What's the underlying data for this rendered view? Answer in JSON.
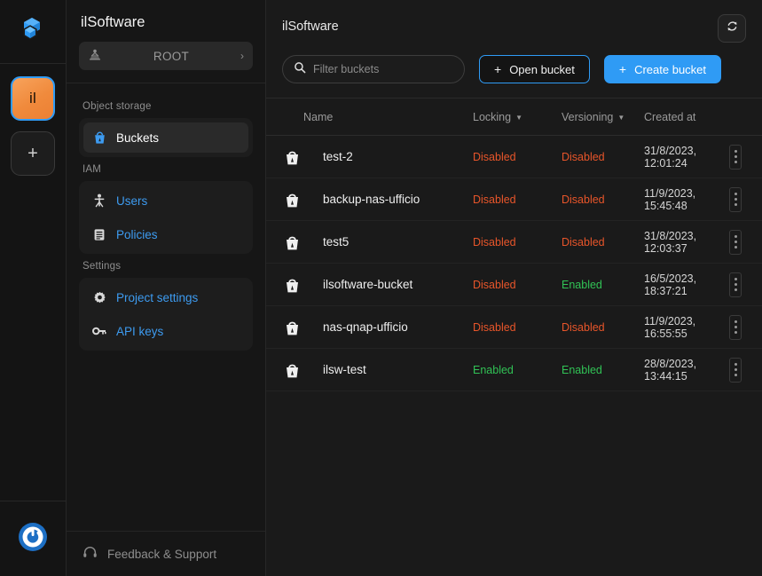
{
  "rail": {
    "logo_icon": "cube-logo-icon",
    "org_tile_label": "il",
    "add_tile_label": "+",
    "bottom_icon": "power-avatar-icon"
  },
  "sidebar": {
    "title": "ilSoftware",
    "org_switcher": {
      "icon": "organization-icon",
      "label": "ROOT",
      "chevron": "›"
    },
    "sections": [
      {
        "label": "Object storage",
        "items": [
          {
            "label": "Buckets",
            "icon": "bucket-icon",
            "active": true
          }
        ]
      },
      {
        "label": "IAM",
        "items": [
          {
            "label": "Users",
            "icon": "user-icon",
            "active": false
          },
          {
            "label": "Policies",
            "icon": "policy-document-icon",
            "active": false
          }
        ]
      },
      {
        "label": "Settings",
        "items": [
          {
            "label": "Project settings",
            "icon": "gear-icon",
            "active": false
          },
          {
            "label": "API keys",
            "icon": "key-icon",
            "active": false
          }
        ]
      }
    ],
    "footer": {
      "label": "Feedback & Support",
      "icon": "headset-icon"
    }
  },
  "main": {
    "title": "ilSoftware",
    "refresh_button": {
      "icon": "refresh-sync-icon",
      "label": ""
    },
    "search": {
      "placeholder": "Filter buckets",
      "value": "",
      "icon": "search-icon"
    },
    "open_bucket_button": {
      "label": "Open bucket",
      "plus": "+"
    },
    "create_bucket_button": {
      "label": "Create bucket",
      "plus": "+"
    },
    "table": {
      "columns": [
        {
          "label": "Name",
          "sortable": false
        },
        {
          "label": "Locking",
          "sortable": true,
          "caret": "▼"
        },
        {
          "label": "Versioning",
          "sortable": true,
          "caret": "▼"
        },
        {
          "label": "Created at",
          "sortable": false
        }
      ],
      "rows": [
        {
          "name": "test-2",
          "locking": "Disabled",
          "locking_state": "off",
          "versioning": "Disabled",
          "versioning_state": "off",
          "created_at": "31/8/2023, 12:01:24"
        },
        {
          "name": "backup-nas-ufficio",
          "locking": "Disabled",
          "locking_state": "off",
          "versioning": "Disabled",
          "versioning_state": "off",
          "created_at": "11/9/2023, 15:45:48"
        },
        {
          "name": "test5",
          "locking": "Disabled",
          "locking_state": "off",
          "versioning": "Disabled",
          "versioning_state": "off",
          "created_at": "31/8/2023, 12:03:37"
        },
        {
          "name": "ilsoftware-bucket",
          "locking": "Disabled",
          "locking_state": "off",
          "versioning": "Enabled",
          "versioning_state": "on",
          "created_at": "16/5/2023, 18:37:21"
        },
        {
          "name": "nas-qnap-ufficio",
          "locking": "Disabled",
          "locking_state": "off",
          "versioning": "Disabled",
          "versioning_state": "off",
          "created_at": "11/9/2023, 16:55:55"
        },
        {
          "name": "ilsw-test",
          "locking": "Enabled",
          "locking_state": "on",
          "versioning": "Enabled",
          "versioning_state": "on",
          "created_at": "28/8/2023, 13:44:15"
        }
      ]
    }
  },
  "colors": {
    "accent_blue": "#2f9bf5",
    "link_blue": "#3d9bf0",
    "status_disabled": "#e8552a",
    "status_enabled": "#31c255",
    "org_tile": "#f08a3c",
    "bg_main": "#1a1a1a",
    "bg_sidebar": "#161616",
    "bg_rail": "#141414"
  }
}
